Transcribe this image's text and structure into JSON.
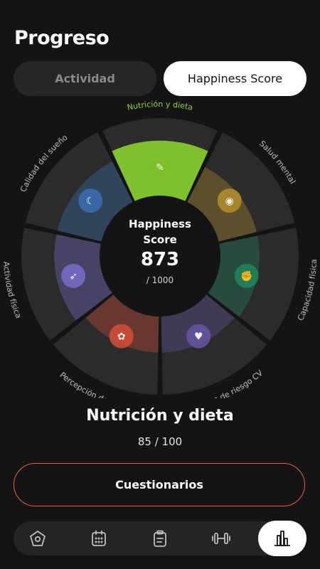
{
  "header": {
    "title": "Progreso"
  },
  "tabs": [
    {
      "label": "Actividad",
      "active": false
    },
    {
      "label": "Happiness Score",
      "active": true
    }
  ],
  "score": {
    "title_line1": "Happiness",
    "title_line2": "Score",
    "value": "873",
    "max": "/ 1000"
  },
  "categories": [
    {
      "label": "Factores de riesgo CV",
      "icon": "heart-icon",
      "color": "#6b57a8",
      "selected": false
    },
    {
      "label": "Percepción de salud",
      "icon": "lotus-icon",
      "color": "#d9503a",
      "selected": false
    },
    {
      "label": "Actividad física",
      "icon": "runner-icon",
      "color": "#7a6fd1",
      "selected": false
    },
    {
      "label": "Calidad del sueño",
      "icon": "moon-icon",
      "color": "#3b73b8",
      "selected": false
    },
    {
      "label": "Nutrición y dieta",
      "icon": "carrot-icon",
      "color": "#7fc12e",
      "selected": true
    },
    {
      "label": "Salud mental",
      "icon": "brain-icon",
      "color": "#b8922e",
      "selected": false
    },
    {
      "label": "Capacidad física",
      "icon": "muscle-icon",
      "color": "#1f8a5e",
      "selected": false
    }
  ],
  "selected": {
    "title": "Nutrición y dieta",
    "score": "85 / 100"
  },
  "cta": {
    "label": "Cuestionarios",
    "accent": "#e2604a"
  },
  "nav": [
    {
      "icon": "home-icon",
      "active": false
    },
    {
      "icon": "calendar-icon",
      "active": false
    },
    {
      "icon": "clipboard-icon",
      "active": false
    },
    {
      "icon": "dumbbell-icon",
      "active": false
    },
    {
      "icon": "bar-chart-icon",
      "active": true
    }
  ]
}
